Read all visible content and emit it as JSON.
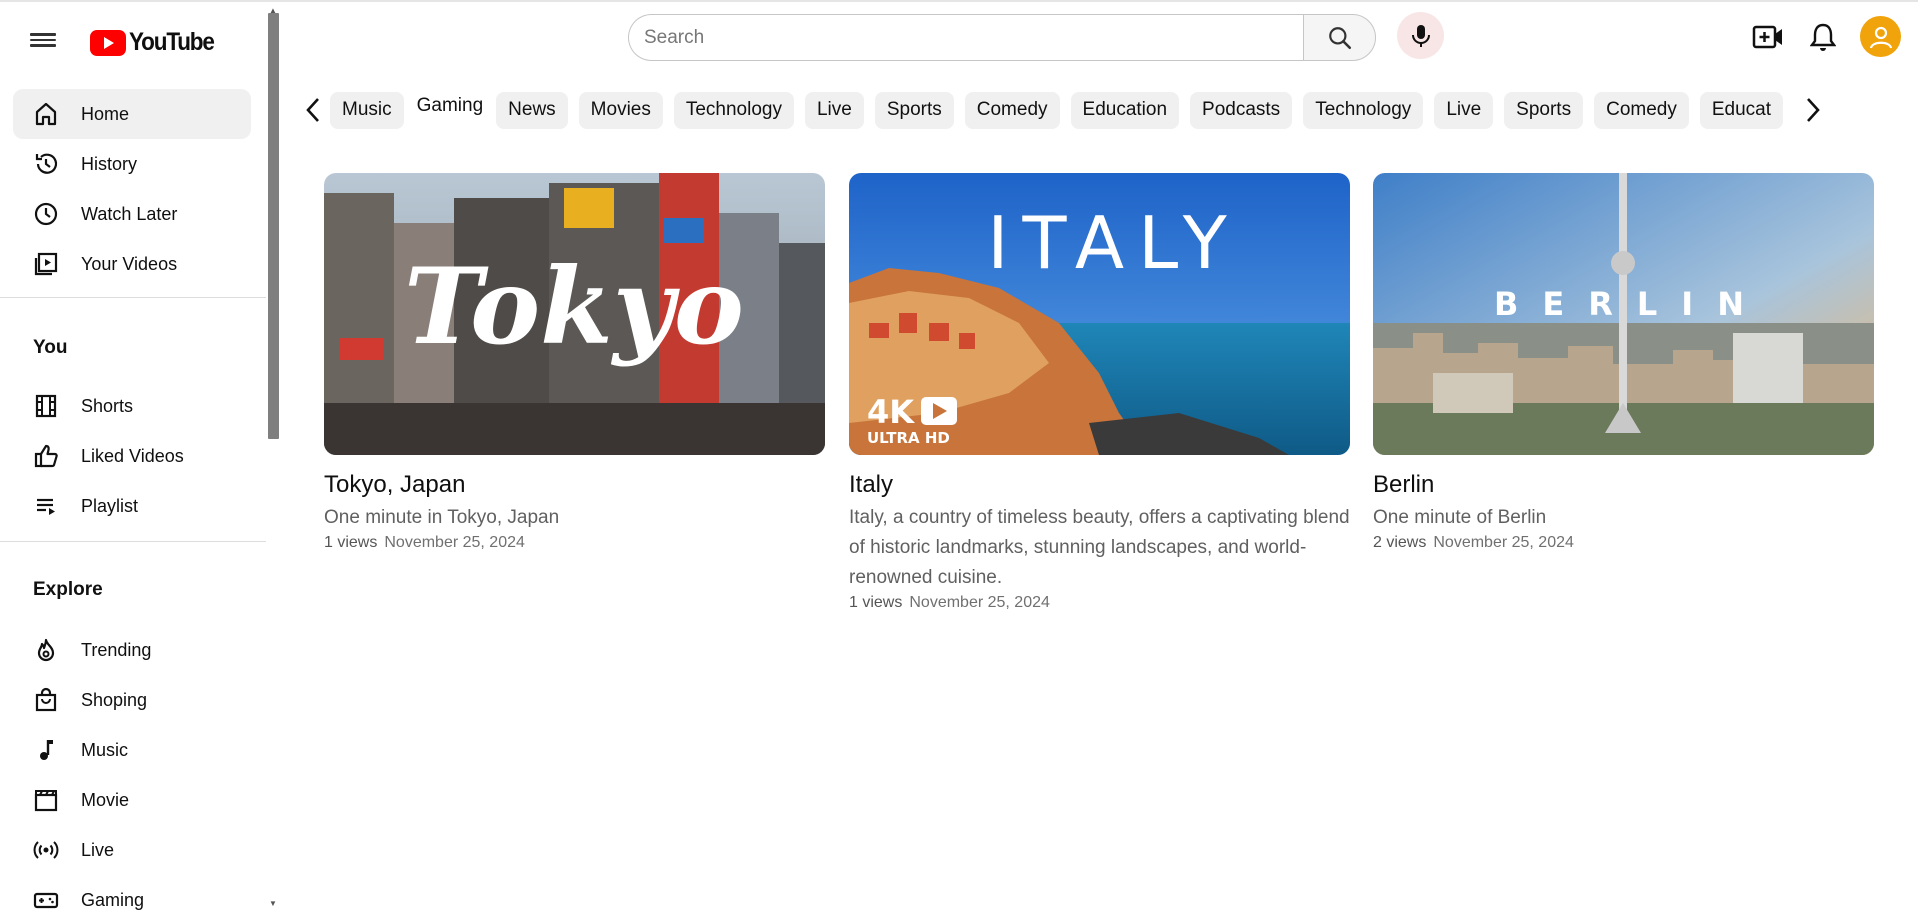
{
  "header": {
    "logo_text": "YouTube",
    "search_placeholder": "Search",
    "brand_red": "#ff0000",
    "avatar_color": "#f0a30a"
  },
  "sidebar": {
    "main_items": [
      {
        "label": "Home",
        "icon": "home-icon",
        "active": true
      },
      {
        "label": "History",
        "icon": "history-icon"
      },
      {
        "label": "Watch Later",
        "icon": "clock-icon"
      },
      {
        "label": "Your Videos",
        "icon": "video-library-icon"
      }
    ],
    "you_heading": "You",
    "you_items": [
      {
        "label": "Shorts",
        "icon": "shorts-icon"
      },
      {
        "label": "Liked Videos",
        "icon": "thumbs-up-icon"
      },
      {
        "label": "Playlist",
        "icon": "playlist-icon"
      }
    ],
    "explore_heading": "Explore",
    "explore_items": [
      {
        "label": "Trending",
        "icon": "fire-icon"
      },
      {
        "label": "Shoping",
        "icon": "shopping-bag-icon"
      },
      {
        "label": "Music",
        "icon": "music-note-icon"
      },
      {
        "label": "Movie",
        "icon": "clapperboard-icon"
      },
      {
        "label": "Live",
        "icon": "live-broadcast-icon"
      },
      {
        "label": "Gaming",
        "icon": "gamepad-icon"
      }
    ]
  },
  "chips": [
    "Music",
    "Gaming",
    "News",
    "Movies",
    "Technology",
    "Live",
    "Sports",
    "Comedy",
    "Education",
    "Podcasts",
    "Technology",
    "Live",
    "Sports",
    "Comedy",
    "Educat"
  ],
  "videos": [
    {
      "title": "Tokyo, Japan",
      "description": "One minute in Tokyo, Japan",
      "views": "1 views",
      "date": "November 25, 2024",
      "thumb_text": "Tokyo"
    },
    {
      "title": "Italy",
      "description": "Italy, a country of timeless beauty, offers a captivating blend of historic landmarks, stunning landscapes, and world-renowned cuisine.",
      "views": "1 views",
      "date": "November 25, 2024",
      "thumb_text": "ITALY",
      "badge_top": "4K",
      "badge_bottom": "ULTRA HD"
    },
    {
      "title": "Berlin",
      "description": "One minute of Berlin",
      "views": "2 views",
      "date": "November 25, 2024",
      "thumb_text": "BERLIN"
    }
  ]
}
